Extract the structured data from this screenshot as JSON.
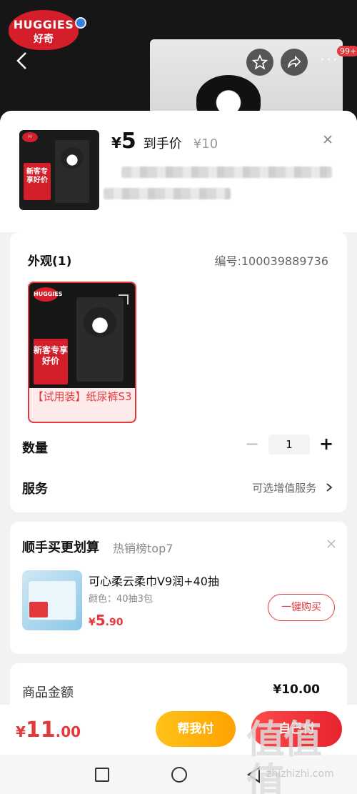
{
  "background": {
    "brand": {
      "line1": "HUGGIES",
      "line2": "好奇"
    },
    "more_icon": "more-dots-icon",
    "cart_badge": "99+"
  },
  "sheet": {
    "price_symbol": "¥",
    "price_value": "5",
    "price_label": "到手价",
    "original_price": "¥10",
    "thumb_tag": "新客专享好价"
  },
  "appearance": {
    "title": "外观(1)",
    "code": "编号:100039889736",
    "variant_tag": "新客专享好价",
    "variant_label": "【试用装】纸尿裤S3"
  },
  "quantity": {
    "label": "数量",
    "value": "1",
    "minus": "−",
    "plus": "+"
  },
  "service": {
    "label": "服务",
    "hint": "可选增值服务"
  },
  "recommend": {
    "title": "顺手买更划算",
    "subtitle": "热销榜top7",
    "name": "可心柔云柔巾V9润+40抽",
    "spec": "颜色：40抽3包",
    "price_symbol": "¥",
    "price_int": "5",
    "price_dec": ".90",
    "buy_label": "一键购买"
  },
  "amount": {
    "label": "商品金额",
    "value": "¥10.00"
  },
  "bottom": {
    "total_symbol": "¥",
    "total_int": "11",
    "total_dec": ".00",
    "help_pay": "帮我付",
    "self_pay": "自己付"
  },
  "watermark": {
    "mark": "值值值",
    "url": "zhizhizhi.com"
  },
  "colors": {
    "accent": "#e4393c",
    "help_pay": "#ffb400",
    "self_pay": "#ef2f36"
  }
}
